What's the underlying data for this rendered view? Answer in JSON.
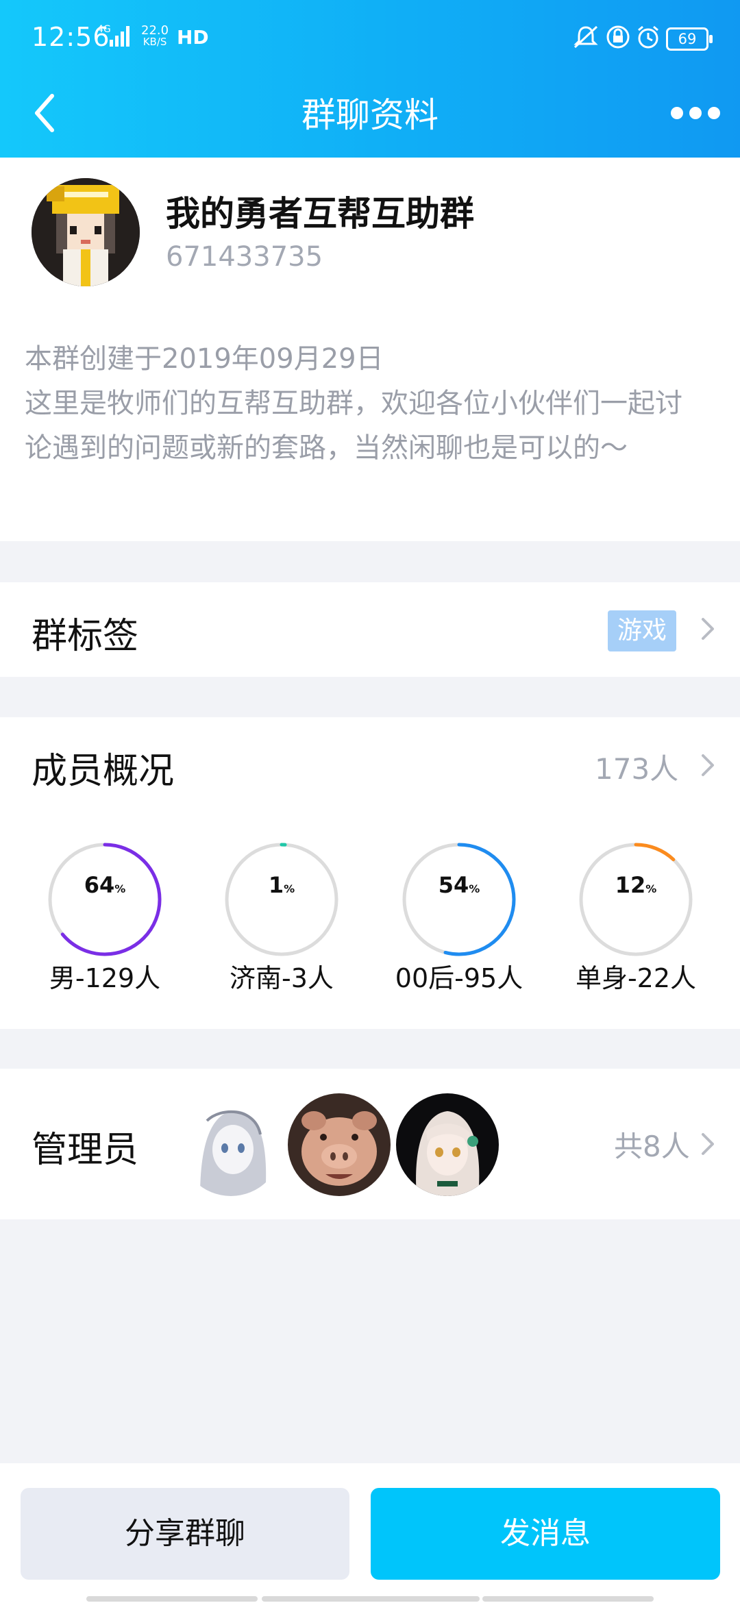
{
  "status_bar": {
    "time": "12:56",
    "network_type": "4G",
    "speed_value": "22.0",
    "speed_unit": "KB/S",
    "hd_label": "HD",
    "battery": "69"
  },
  "nav": {
    "title": "群聊资料",
    "back_icon": "chevron-left-icon",
    "more_icon": "more-dots-icon"
  },
  "group": {
    "name": "我的勇者互帮互助群",
    "id": "671433735",
    "description": "本群创建于2019年09月29日\n这里是牧师们的互帮互助群，欢迎各位小伙伴们一起讨论遇到的问题或新的套路，当然闲聊也是可以的～"
  },
  "tags_row": {
    "label": "群标签",
    "tag": "游戏"
  },
  "members": {
    "label": "成员概况",
    "count": "173人",
    "stats": [
      {
        "pct": "64",
        "unit": "%",
        "label": "男-129人",
        "value": 0.64,
        "color": "#7a2ee6"
      },
      {
        "pct": "1",
        "unit": "%",
        "label": "济南-3人",
        "value": 0.01,
        "color": "#21c7a8"
      },
      {
        "pct": "54",
        "unit": "%",
        "label": "00后-95人",
        "value": 0.54,
        "color": "#1f8cf0"
      },
      {
        "pct": "12",
        "unit": "%",
        "label": "单身-22人",
        "value": 0.12,
        "color": "#fb8b1e"
      }
    ]
  },
  "admins": {
    "label": "管理员",
    "count": "共8人"
  },
  "actions": {
    "share": "分享群聊",
    "send": "发消息"
  },
  "colors": {
    "header_start": "#14c8fb",
    "header_end": "#1099f2",
    "send_button": "#00c5fb",
    "tag_chip": "#a6cff8"
  }
}
